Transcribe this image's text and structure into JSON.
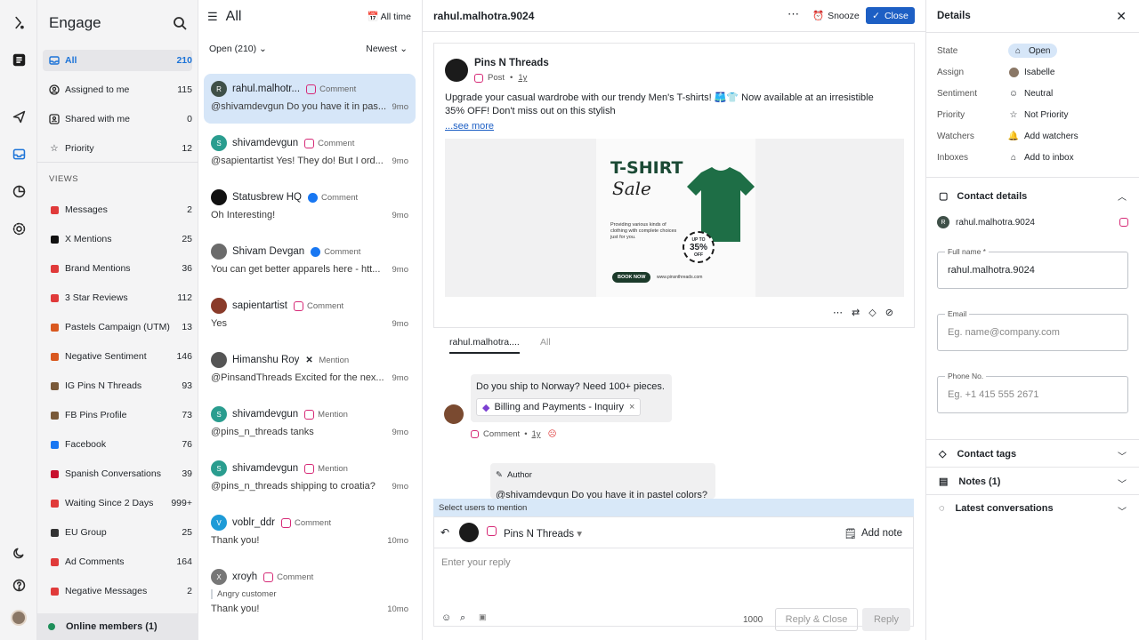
{
  "app": {
    "title": "Engage"
  },
  "sidebar": {
    "items": [
      {
        "label": "All",
        "count": "210",
        "icon": "inbox-icon",
        "selected": true
      },
      {
        "label": "Assigned to me",
        "count": "115",
        "icon": "user-circle-icon"
      },
      {
        "label": "Shared with me",
        "count": "0",
        "icon": "share-icon"
      },
      {
        "label": "Priority",
        "count": "12",
        "icon": "star-icon"
      }
    ],
    "views_label": "VIEWS",
    "views": [
      {
        "label": "Messages",
        "count": "2",
        "color": "#e03a3a"
      },
      {
        "label": "X Mentions",
        "count": "25",
        "color": "#111111"
      },
      {
        "label": "Brand Mentions",
        "count": "36",
        "color": "#e03a3a"
      },
      {
        "label": "3 Star Reviews",
        "count": "112",
        "color": "#e03a3a"
      },
      {
        "label": "Pastels Campaign (UTM)",
        "count": "13",
        "color": "#d9581f"
      },
      {
        "label": "Negative Sentiment",
        "count": "146",
        "color": "#d9581f"
      },
      {
        "label": "IG Pins N Threads",
        "count": "93",
        "color": "#7a5a3a"
      },
      {
        "label": "FB Pins Profile",
        "count": "73",
        "color": "#7a5a3a"
      },
      {
        "label": "Facebook",
        "count": "76",
        "color": "#1877f2"
      },
      {
        "label": "Spanish Conversations",
        "count": "39",
        "color": "#c8102e"
      },
      {
        "label": "Waiting Since 2 Days",
        "count": "999+",
        "color": "#e03a3a"
      },
      {
        "label": "EU Group",
        "count": "25",
        "color": "#333333"
      },
      {
        "label": "Ad Comments",
        "count": "164",
        "color": "#e03a3a"
      },
      {
        "label": "Negative Messages",
        "count": "2",
        "color": "#e03a3a"
      }
    ],
    "online": "Online members (1)"
  },
  "list": {
    "title": "All",
    "time_filter": "All time",
    "status_filter": "Open (210)",
    "sort": "Newest",
    "items": [
      {
        "name": "rahul.malhotr...",
        "channel": "instagram",
        "type": "Comment",
        "msg": "@shivamdevgun Do you have it in pas...",
        "time": "9mo",
        "avatar": "R",
        "avcolor": "#3f5048"
      },
      {
        "name": "shivamdevgun",
        "channel": "instagram",
        "type": "Comment",
        "msg": "@sapientartist Yes! They do! But I ord...",
        "time": "9mo",
        "avatar": "S",
        "avcolor": "#2a9d8f"
      },
      {
        "name": "Statusbrew HQ",
        "channel": "facebook",
        "type": "Comment",
        "msg": "Oh Interesting!",
        "time": "9mo",
        "avatar": "",
        "avcolor": "#111111"
      },
      {
        "name": "Shivam Devgan",
        "channel": "facebook",
        "type": "Comment",
        "msg": "You can get better apparels here - htt...",
        "time": "9mo",
        "avatar": "",
        "avcolor": "#6b6b6b"
      },
      {
        "name": "sapientartist",
        "channel": "instagram",
        "type": "Comment",
        "msg": "Yes",
        "time": "9mo",
        "avatar": "",
        "avcolor": "#8a3b2a"
      },
      {
        "name": "Himanshu Roy",
        "channel": "x",
        "type": "Mention",
        "msg": "@PinsandThreads Excited for the nex...",
        "time": "9mo",
        "avatar": "",
        "avcolor": "#555555"
      },
      {
        "name": "shivamdevgun",
        "channel": "instagram",
        "type": "Mention",
        "msg": "@pins_n_threads tanks",
        "time": "9mo",
        "avatar": "S",
        "avcolor": "#2a9d8f"
      },
      {
        "name": "shivamdevgun",
        "channel": "instagram",
        "type": "Mention",
        "msg": "@pins_n_threads shipping to croatia?",
        "time": "9mo",
        "avatar": "S",
        "avcolor": "#2a9d8f"
      },
      {
        "name": "voblr_ddr",
        "channel": "instagram",
        "type": "Comment",
        "msg": "Thank you!",
        "time": "10mo",
        "avatar": "V",
        "avcolor": "#1e9bd7"
      },
      {
        "name": "xroyh",
        "channel": "instagram",
        "type": "Comment",
        "note": "Angry customer",
        "msg": "Thank you!",
        "time": "10mo",
        "avatar": "X",
        "avcolor": "#777777"
      }
    ]
  },
  "main": {
    "title": "rahul.malhotra.9024",
    "snooze": "Snooze",
    "close": "Close",
    "post": {
      "author": "Pins N Threads",
      "type": "Post",
      "age": "1y",
      "text": "Upgrade your casual wardrobe with our trendy Men's T-shirts! 🩳👕 Now available at an irresistible 35% OFF! Don't miss out on this stylish",
      "see_more": "...see more",
      "ad": {
        "headline": "T-SHIRT",
        "script": "Sale",
        "copy": "Providing various kinds of clothing with complete choices just for you.",
        "badge_top": "UP TO",
        "badge_pct": "35%",
        "badge_bottom": "OFF",
        "cta": "BOOK NOW",
        "url": "www.pinsnthreads.com"
      }
    },
    "tabs": [
      "rahul.malhotra....",
      "All"
    ],
    "comment": {
      "text": "Do you ship to Norway? Need 100+ pieces.",
      "tag": "Billing and Payments - Inquiry",
      "type": "Comment",
      "age": "1y"
    },
    "author_reply": {
      "label": "Author",
      "text": "@shivamdevgun Do you have it in pastel colors?",
      "handle": "@shivamdevgun"
    },
    "mention_hint": "Select users to mention",
    "composer": {
      "account": "Pins N Threads",
      "add_note": "Add note",
      "placeholder": "Enter your reply",
      "char_count": "1000",
      "reply_close": "Reply & Close",
      "reply": "Reply"
    }
  },
  "details": {
    "title": "Details",
    "rows": [
      {
        "key": "State",
        "value": "Open"
      },
      {
        "key": "Assign",
        "value": "Isabelle"
      },
      {
        "key": "Sentiment",
        "value": "Neutral"
      },
      {
        "key": "Priority",
        "value": "Not Priority"
      },
      {
        "key": "Watchers",
        "value": "Add watchers"
      },
      {
        "key": "Inboxes",
        "value": "Add to inbox"
      }
    ],
    "contact_title": "Contact details",
    "contact_handle": "rahul.malhotra.9024",
    "full_name_label": "Full name *",
    "full_name": "rahul.malhotra.9024",
    "email_label": "Email",
    "email_ph": "Eg. name@company.com",
    "phone_label": "Phone No.",
    "phone_ph": "Eg. +1 415 555 2671",
    "sections": [
      "Contact tags",
      "Notes (1)",
      "Latest conversations"
    ]
  }
}
